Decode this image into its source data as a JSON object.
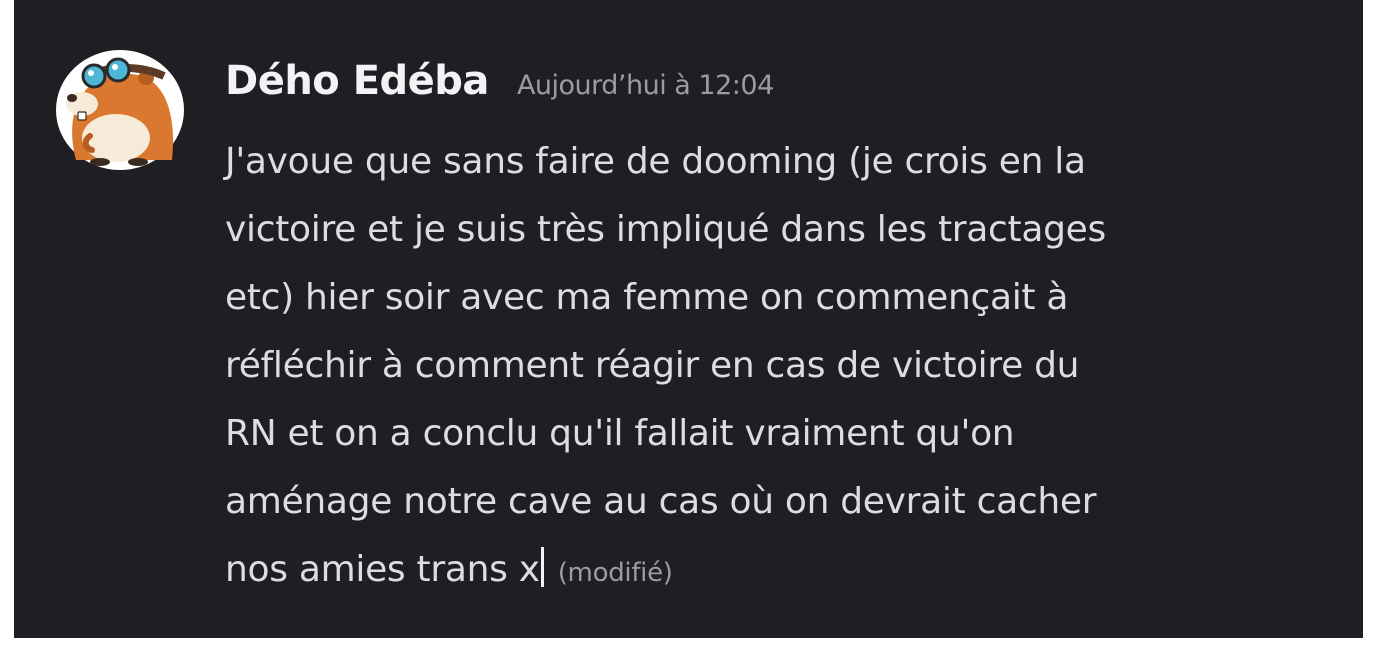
{
  "message": {
    "author": "Dého Edéba",
    "timestamp": "Aujourd’hui à 12:04",
    "lines": [
      "J'avoue que sans faire de dooming (je crois en la",
      "victoire et je suis très impliqué dans les tractages",
      "etc) hier soir avec ma femme on commençait à",
      "réfléchir à comment réagir en cas de victoire du",
      "RN et on a conclu qu'il fallait vraiment qu'on",
      "aménage notre cave au cas où on devrait cacher",
      "nos amies trans x"
    ],
    "edited_label": "(modifié)",
    "avatar_icon": "groundhog-with-goggles-icon"
  },
  "colors": {
    "background": "#1f1f23",
    "author": "#f2f3f5",
    "text": "#dcdde0",
    "muted": "#9a9ba3"
  }
}
